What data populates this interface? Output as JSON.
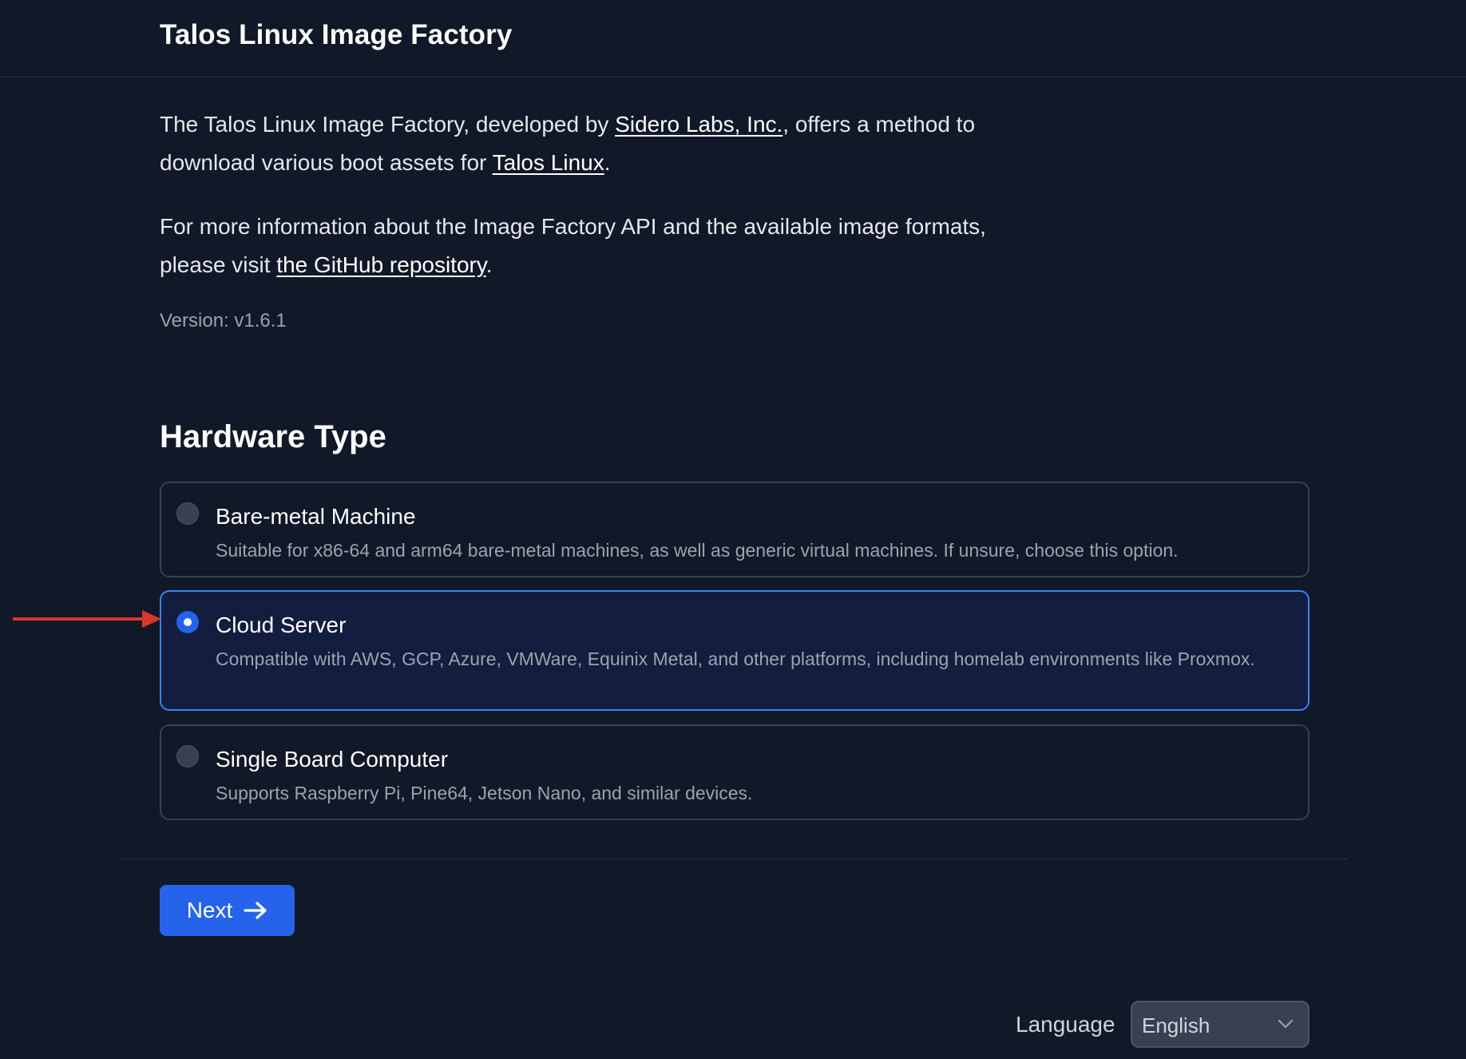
{
  "header": {
    "title": "Talos Linux Image Factory"
  },
  "intro": {
    "p1_before": "The Talos Linux Image Factory, developed by ",
    "p1_link1": "Sidero Labs, Inc.",
    "p1_middle": ", offers a method to download various boot assets for ",
    "p1_link2": "Talos Linux",
    "p1_after": ".",
    "p2_before": "For more information about the Image Factory API and the available image formats, please visit ",
    "p2_link": "the GitHub repository",
    "p2_after": "."
  },
  "version": "Version: v1.6.1",
  "hardware": {
    "title": "Hardware Type",
    "selected_index": 1,
    "options": [
      {
        "title": "Bare-metal Machine",
        "description": "Suitable for x86-64 and arm64 bare-metal machines, as well as generic virtual machines. If unsure, choose this option."
      },
      {
        "title": "Cloud Server",
        "description": "Compatible with AWS, GCP, Azure, VMWare, Equinix Metal, and other platforms, including homelab environments like Proxmox."
      },
      {
        "title": "Single Board Computer",
        "description": "Supports Raspberry Pi, Pine64, Jetson Nano, and similar devices."
      }
    ]
  },
  "next_button": {
    "label": "Next",
    "icon": "arrow-right-icon"
  },
  "language": {
    "label": "Language",
    "selected": "English"
  },
  "annotation": {
    "icon": "red-arrow-pointer",
    "color": "#d9372b"
  },
  "colors": {
    "background": "#111827",
    "accent": "#2563eb",
    "selected_border": "#3b82f6",
    "selected_bg": "#131d3e"
  }
}
